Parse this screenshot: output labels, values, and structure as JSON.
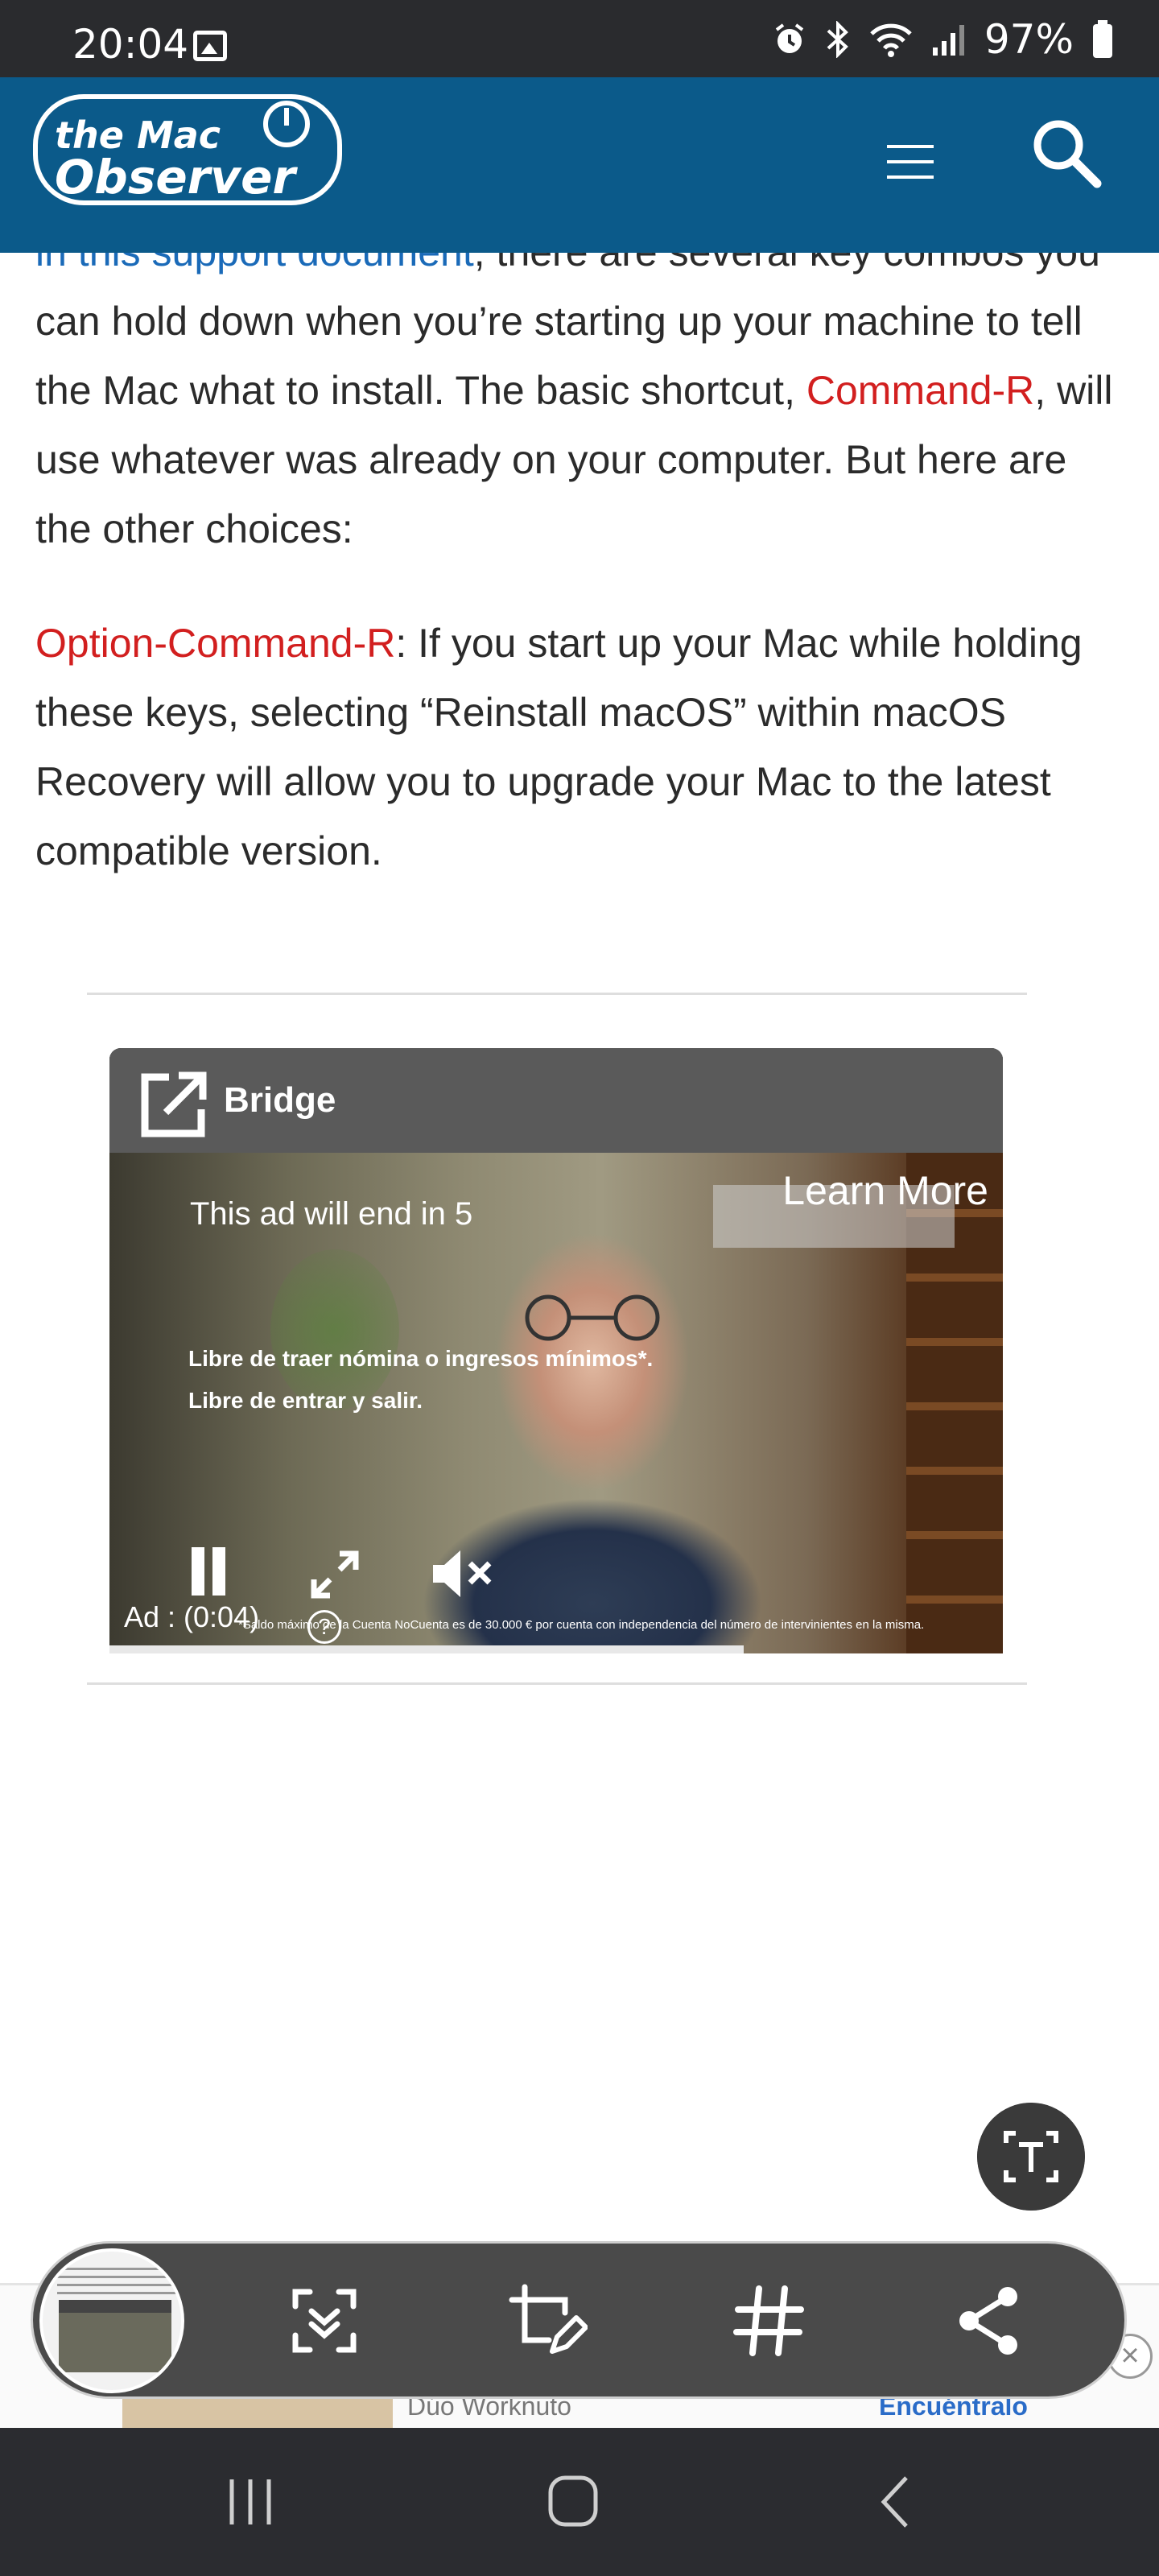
{
  "status_bar": {
    "time": "20:04",
    "battery": "97%",
    "icons": [
      "image-icon",
      "alarm-icon",
      "bluetooth-icon",
      "wifi-icon",
      "signal-icon",
      "battery-icon"
    ]
  },
  "header": {
    "logo_line1": "the Mac",
    "logo_line2": "Observer",
    "background": "#0b5a8a"
  },
  "article": {
    "p1_link": "in this support document",
    "p1_text_a": ", there are several key combos you can hold down when you’re starting up your machine to tell the Mac what to install. The basic shortcut, ",
    "p1_highlight": "Command-R",
    "p1_text_b": ", will use whatever was already on your computer. But here are the other choices:",
    "p2_highlight": "Option-Command-R",
    "p2_text": ": If you start up your Mac while holding these keys, selecting “Reinstall macOS” within macOS Recovery will allow you to upgrade your Mac to the latest compatible version.",
    "highlight_color": "#d21f1f",
    "link_color": "#1a6ab8"
  },
  "ad": {
    "bar_title": "Bridge",
    "countdown": "This ad will end in 5",
    "learn_more": "Learn More",
    "copy_line1": "Libre de traer nómina o ingresos mínimos*.",
    "copy_line2": "Libre de entrar y salir.",
    "fine_print": "*Saldo máximo de la Cuenta NoCuenta es de 30.000 € por cuenta con independencia del número de intervinientes en la misma.",
    "time": "Ad : (0:04)",
    "info": "?",
    "progress": 0.71
  },
  "bottom_ad": {
    "brand": "Dúo Worknuto",
    "cta": "Encuéntralo",
    "close": "×"
  },
  "toolbar": {
    "tools": [
      "scroll-capture-icon",
      "crop-edit-icon",
      "hashtag-icon",
      "share-icon"
    ]
  },
  "nav_bar": {
    "buttons": [
      "recent-apps-icon",
      "home-icon",
      "back-icon"
    ]
  }
}
